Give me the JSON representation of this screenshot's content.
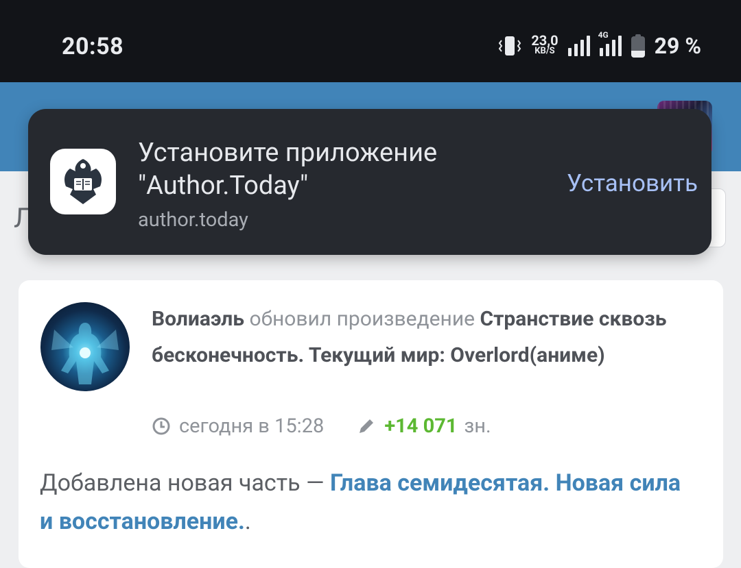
{
  "status_bar": {
    "time": "20:58",
    "speed_value": "23,0",
    "speed_unit": "KB/S",
    "network_type": "4G",
    "battery": "29 %",
    "icons": [
      "vibrate-icon",
      "wifi-signal-icon",
      "cellular-signal-icon",
      "battery-icon"
    ]
  },
  "install_banner": {
    "title": "Установите приложение \"Author.Today\"",
    "url": "author.today",
    "install_label": "Установить",
    "icon": "author-today-logo-icon"
  },
  "background": {
    "cut_letter": "Л"
  },
  "feed_item": {
    "author": "Волиаэль",
    "action": "обновил произведение",
    "work_title": "Странствие сквозь бесконечность. Текущий мир: Overlord(аниме)",
    "time": "сегодня в 15:28",
    "chars_added": "+14 071",
    "chars_unit": "зн.",
    "update_text": "Добавлена новая часть —",
    "chapter_title": "Глава семидесятая. Новая сила и восстановление.",
    "trailing": "."
  },
  "colors": {
    "status_bar_bg": "#121418",
    "header_bg": "#4184b8",
    "banner_bg": "#26292f",
    "install_link": "#a7c0f5",
    "accent_green": "#5cb832",
    "link_blue": "#4184b8"
  }
}
